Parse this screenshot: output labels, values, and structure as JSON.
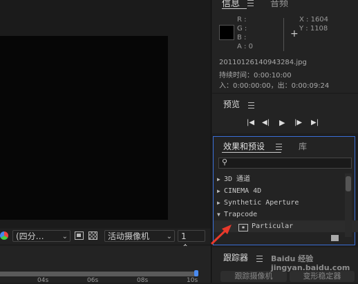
{
  "info": {
    "tabs": [
      "信息",
      "音频"
    ],
    "r_label": "R :",
    "g_label": "G :",
    "b_label": "B :",
    "a_label": "A : 0",
    "x_label": "X : 1604",
    "y_label": "Y : 1108",
    "file": "20110126140943284.jpg",
    "duration": "持续时间：0:00:10:00",
    "inout": "入：0:00:00:00，出：0:00:09:24"
  },
  "preview": {
    "title": "预览"
  },
  "effects": {
    "tabs": [
      "效果和预设",
      "库"
    ],
    "search_placeholder": "",
    "items": [
      {
        "label": "3D 通道",
        "expanded": false
      },
      {
        "label": "CINEMA 4D",
        "expanded": false
      },
      {
        "label": "Synthetic Aperture",
        "expanded": false
      },
      {
        "label": "Trapcode",
        "expanded": true
      },
      {
        "label": "Particular",
        "child": true
      }
    ]
  },
  "tracker": {
    "title": "跟踪器",
    "track_camera": "跟踪摄像机",
    "warp_stabilizer": "变形稳定器"
  },
  "viewer": {
    "resolution": "(四分…",
    "camera": "活动摄像机",
    "views": "1 个…"
  },
  "timeline": {
    "ticks": [
      "04s",
      "06s",
      "08s",
      "10s"
    ]
  },
  "watermark": "Baidu 经验 jingyan.baidu.com",
  "colors": {
    "accent": "#3a6fd8",
    "arrow": "#e8392b",
    "bg": "#1d1d1d"
  }
}
